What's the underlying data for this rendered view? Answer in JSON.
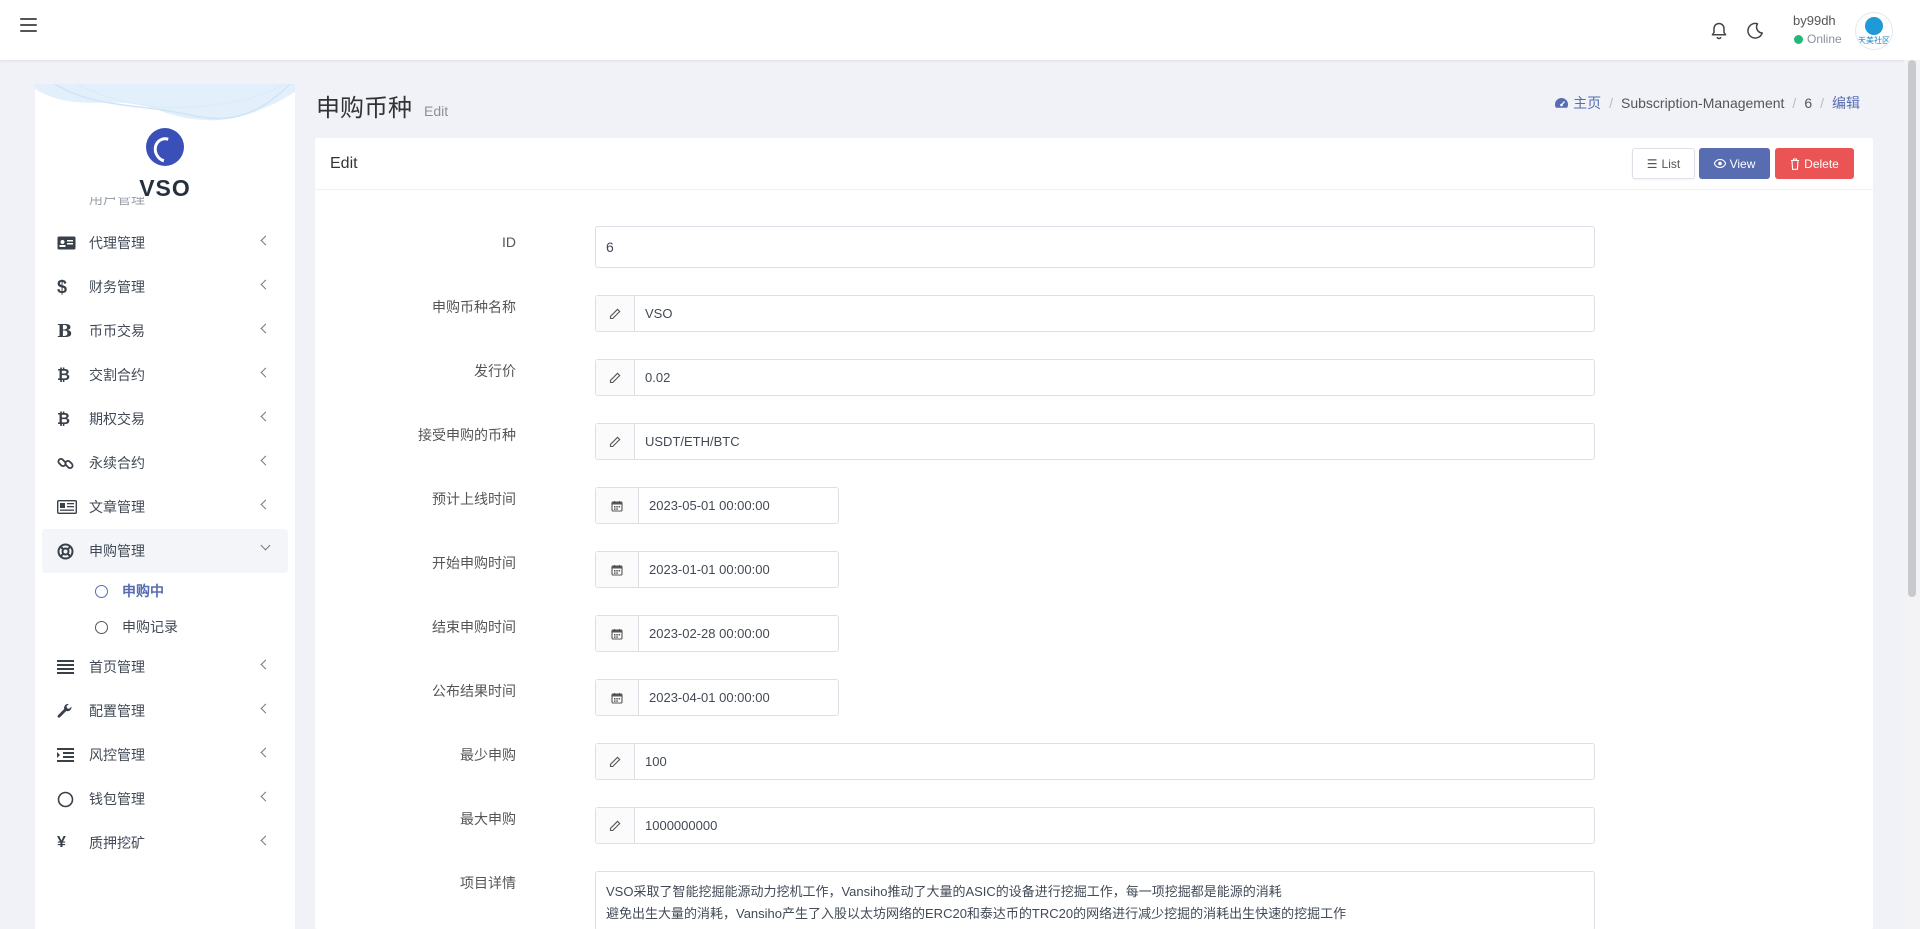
{
  "topbar": {
    "user_name": "by99dh",
    "user_status": "Online",
    "avatar_text": "天美社区"
  },
  "sidebar": {
    "brand_name": "VSO",
    "cut_item": "用户管理",
    "items": [
      {
        "label": "代理管理",
        "icon": "id-card-icon"
      },
      {
        "label": "财务管理",
        "icon": "dollar-icon"
      },
      {
        "label": "币币交易",
        "icon": "bold-b-icon"
      },
      {
        "label": "交割合约",
        "icon": "bitcoin-icon"
      },
      {
        "label": "期权交易",
        "icon": "bitcoin-icon"
      },
      {
        "label": "永续合约",
        "icon": "link-icon"
      },
      {
        "label": "文章管理",
        "icon": "newspaper-icon"
      }
    ],
    "open_item": {
      "label": "申购管理",
      "icon": "lifebuoy-icon"
    },
    "sub_items": [
      {
        "label": "申购中",
        "active": true
      },
      {
        "label": "申购记录",
        "active": false
      }
    ],
    "items_after": [
      {
        "label": "首页管理",
        "icon": "bars-icon"
      },
      {
        "label": "配置管理",
        "icon": "wrench-icon"
      },
      {
        "label": "风控管理",
        "icon": "indent-icon"
      },
      {
        "label": "钱包管理",
        "icon": "circle-icon"
      },
      {
        "label": "质押挖矿",
        "icon": "yen-icon"
      }
    ]
  },
  "header": {
    "title": "申购币种",
    "subtitle": "Edit",
    "breadcrumb": {
      "home": "主页",
      "section": "Subscription-Management",
      "id": "6",
      "current": "编辑"
    }
  },
  "card": {
    "title": "Edit",
    "buttons": {
      "list": "List",
      "view": "View",
      "delete": "Delete"
    },
    "fields": {
      "id": {
        "label": "ID",
        "value": "6"
      },
      "name": {
        "label": "申购币种名称",
        "value": "VSO"
      },
      "price": {
        "label": "发行价",
        "value": "0.02"
      },
      "accepted": {
        "label": "接受申购的币种",
        "value": "USDT/ETH/BTC"
      },
      "launch": {
        "label": "预计上线时间",
        "value": "2023-05-01 00:00:00"
      },
      "start": {
        "label": "开始申购时间",
        "value": "2023-01-01 00:00:00"
      },
      "end": {
        "label": "结束申购时间",
        "value": "2023-02-28 00:00:00"
      },
      "publish": {
        "label": "公布结果时间",
        "value": "2023-04-01 00:00:00"
      },
      "min": {
        "label": "最少申购",
        "value": "100"
      },
      "max": {
        "label": "最大申购",
        "value": "1000000000"
      },
      "detail": {
        "label": "项目详情",
        "line1": "VSO采取了智能挖掘能源动力挖机工作，Vansiho推动了大量的ASIC的设备进行挖掘工作，每一项挖掘都是能源的消耗",
        "line2": "避免出生大量的消耗，Vansiho产生了入股以太坊网络的ERC20和泰达币的TRC20的网络进行减少挖掘的消耗出生快速的挖掘工作"
      }
    }
  },
  "colors": {
    "accent": "#586cb1",
    "danger": "#ea5455",
    "online": "#21b978",
    "background": "#f0f2f7"
  }
}
